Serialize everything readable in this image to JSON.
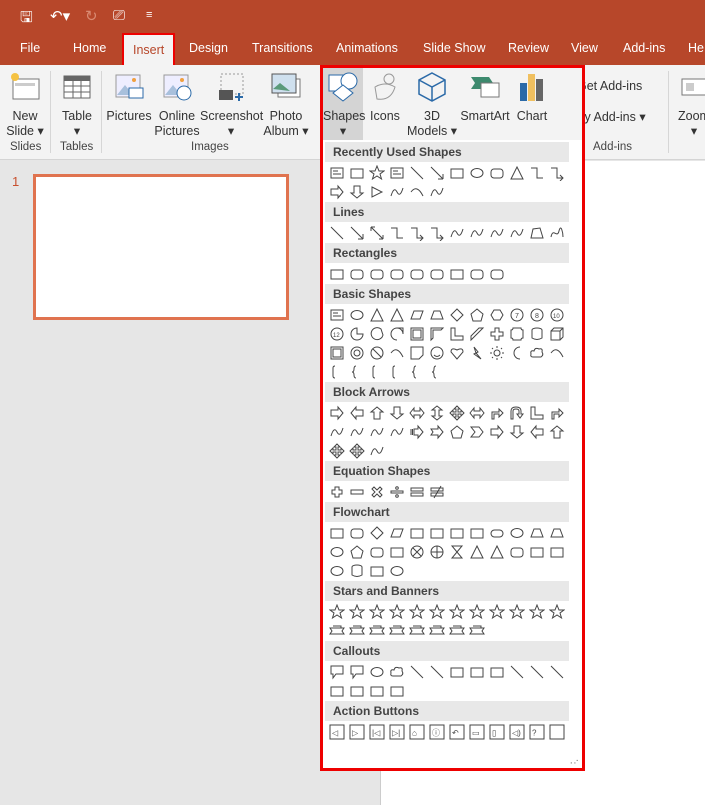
{
  "qat": {
    "save": "save-icon",
    "undo": "undo-icon",
    "redo": "redo-icon",
    "present": "present-icon",
    "customize": "customize-icon"
  },
  "tabs": [
    "File",
    "Home",
    "Insert",
    "Design",
    "Transitions",
    "Animations",
    "Slide Show",
    "Review",
    "View",
    "Add-ins",
    "He"
  ],
  "ribbon": {
    "new_slide": [
      "New",
      "Slide ▾"
    ],
    "table": [
      "Table",
      "▾"
    ],
    "pictures": "Pictures",
    "online_pictures": [
      "Online",
      "Pictures"
    ],
    "screenshot": [
      "Screenshot",
      "▾"
    ],
    "photo_album": [
      "Photo",
      "Album ▾"
    ],
    "shapes": [
      "Shapes",
      "▾"
    ],
    "icons": "Icons",
    "models": [
      "3D",
      "Models ▾"
    ],
    "smartart": "SmartArt",
    "chart": "Chart",
    "get_addins": "Get Add-ins",
    "my_addins": "My Add-ins",
    "zoom": [
      "Zoom",
      "▾"
    ],
    "groups": {
      "slides": "Slides",
      "tables": "Tables",
      "images": "Images",
      "addins": "Add-ins"
    }
  },
  "slide_number": "1",
  "gallery": [
    {
      "title": "Recently Used Shapes",
      "shapes": [
        "textbox",
        "rect",
        "star",
        "textbox",
        "line",
        "arrowline",
        "rect",
        "oval",
        "roundrect",
        "triangle",
        "elbow",
        "elbowarrow",
        "rightarrow",
        "downarrow",
        "tri-right",
        "curve",
        "arc",
        "curve"
      ]
    },
    {
      "title": "Lines",
      "shapes": [
        "line",
        "arrowline",
        "dblarrow",
        "elbow",
        "elbowarrow",
        "elbowarrow",
        "curve",
        "curve",
        "curve",
        "curve",
        "freeform",
        "scribble"
      ]
    },
    {
      "title": "Rectangles",
      "shapes": [
        "rect",
        "roundrect",
        "roundrect",
        "roundrect",
        "roundrect",
        "roundrect",
        "rect",
        "roundrect",
        "roundrect"
      ]
    },
    {
      "title": "Basic Shapes",
      "shapes": [
        "textbox",
        "oval",
        "triangle",
        "triangle",
        "parallelogram",
        "trapezoid",
        "diamond",
        "pentagon",
        "hexagon",
        "heptagon",
        "octagon",
        "decagon",
        "dodecagon",
        "pie",
        "chord",
        "teardrop",
        "frame",
        "halfframe",
        "lshape",
        "diagstripe",
        "cross",
        "plaque",
        "can",
        "cube",
        "bevel",
        "donut",
        "nosymbol",
        "arc",
        "fold",
        "smiley",
        "heart",
        "bolt",
        "sun",
        "moon",
        "cloud",
        "arc",
        "bracket",
        "brace",
        "bracket",
        "bracket",
        "brace",
        "brace"
      ]
    },
    {
      "title": "Block Arrows",
      "shapes": [
        "rightarrow",
        "leftarrow",
        "uparrow",
        "downarrow",
        "lrarrow",
        "udarrow",
        "quadarrow",
        "lrarrow",
        "bentarrow",
        "uturn",
        "lshape",
        "bentarrow",
        "curve",
        "curve",
        "curve",
        "curve",
        "striped",
        "notched",
        "pentagon",
        "chevron",
        "rightarrow",
        "downarrow",
        "leftarrow",
        "uparrow",
        "quadarrow",
        "quadarrow",
        "curve"
      ]
    },
    {
      "title": "Equation Shapes",
      "shapes": [
        "plus",
        "minus",
        "multiply",
        "divide",
        "equal",
        "notequal"
      ]
    },
    {
      "title": "Flowchart",
      "shapes": [
        "rect",
        "roundrect",
        "diamond",
        "parallelogram",
        "rect",
        "rect",
        "rect",
        "rect",
        "terminator",
        "oval",
        "trapezoid",
        "trapezoid",
        "oval",
        "pentagon",
        "roundrect",
        "rect",
        "xcircle",
        "pluscircle",
        "hourglass",
        "triangle",
        "triangle",
        "roundrect",
        "rect",
        "rect",
        "oval",
        "can",
        "rect",
        "oval"
      ]
    },
    {
      "title": "Stars and Banners",
      "shapes": [
        "star",
        "star",
        "star",
        "star",
        "star",
        "star",
        "star",
        "star",
        "star",
        "star",
        "star",
        "star",
        "banner",
        "banner",
        "banner",
        "banner",
        "banner",
        "banner",
        "banner",
        "banner"
      ]
    },
    {
      "title": "Callouts",
      "shapes": [
        "callout",
        "callout",
        "oval",
        "cloud",
        "line",
        "line",
        "rect",
        "rect",
        "rect",
        "line",
        "line",
        "line",
        "rect",
        "rect",
        "rect",
        "rect"
      ]
    },
    {
      "title": "Action Buttons",
      "shapes": [
        "rect",
        "rect",
        "rect",
        "rect",
        "rect",
        "rect",
        "rect",
        "rect",
        "rect",
        "rect",
        "rect",
        "rect"
      ]
    }
  ],
  "gallery_labels": {
    "ab": [
      "◁",
      "▷",
      "|◁",
      "▷|",
      "⌂",
      "ⓘ",
      "↶",
      "▭",
      "▯",
      "◁)",
      "?",
      ""
    ]
  },
  "colors": {
    "accent": "#b7472a",
    "highlight": "#e00000",
    "thumb_border": "#e0734f"
  }
}
